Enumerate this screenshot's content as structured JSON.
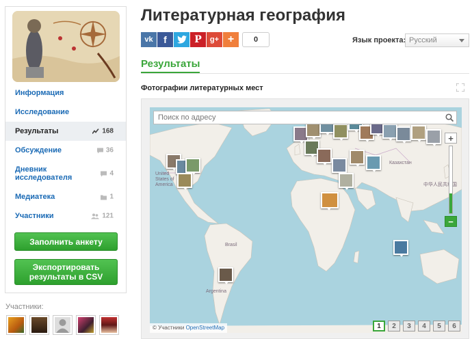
{
  "page": {
    "title": "Литературная география",
    "lang_label": "Язык проекта:",
    "lang_value": "Русский",
    "share_count": "0",
    "results_tab": "Результаты",
    "section_title": "Фотографии литературных мест"
  },
  "share_icons": [
    {
      "name": "vk-share-icon",
      "glyph": "vk",
      "color": "#4a76a8"
    },
    {
      "name": "facebook-share-icon",
      "glyph": "f",
      "color": "#3b5998"
    },
    {
      "name": "twitter-share-icon",
      "glyph": "t",
      "color": "#2ea7e0"
    },
    {
      "name": "pinterest-share-icon",
      "glyph": "P",
      "color": "#cb2027"
    },
    {
      "name": "googleplus-share-icon",
      "glyph": "g+",
      "color": "#dd4b39"
    },
    {
      "name": "more-share-icon",
      "glyph": "+",
      "color": "#f07f3c"
    }
  ],
  "sidebar": {
    "items": [
      {
        "label": "Информация",
        "count": "",
        "icon": ""
      },
      {
        "label": "Исследование",
        "count": "",
        "icon": ""
      },
      {
        "label": "Результаты",
        "count": "168",
        "icon": "chart-icon"
      },
      {
        "label": "Обсуждение",
        "count": "36",
        "icon": "comment-icon"
      },
      {
        "label": "Дневник исследователя",
        "count": "4",
        "icon": "comment-icon"
      },
      {
        "label": "Медиатека",
        "count": "1",
        "icon": "folder-icon"
      },
      {
        "label": "Участники",
        "count": "121",
        "icon": "users-icon"
      }
    ],
    "fill_form_button": "Заполнить анкету",
    "export_button": "Экспортировать результаты в CSV",
    "participants_label": "Участники:"
  },
  "map": {
    "search_placeholder": "Поиск по адресу",
    "attribution_prefix": "© Участники ",
    "attribution_link": "OpenStreetMap",
    "labels": {
      "usa": "United States of America",
      "brasil": "Brasil",
      "argentina": "Argentina",
      "kazakhstan": "Казахстан",
      "china": "中华人民共和国"
    },
    "pages": [
      "1",
      "2",
      "3",
      "4",
      "5",
      "6"
    ],
    "active_page": "1",
    "zoom_level": 0.3
  },
  "colors": {
    "accent_green": "#3aa63a",
    "link_blue": "#1a6ab5",
    "water": "#aad3df",
    "land": "#f2efe9"
  }
}
